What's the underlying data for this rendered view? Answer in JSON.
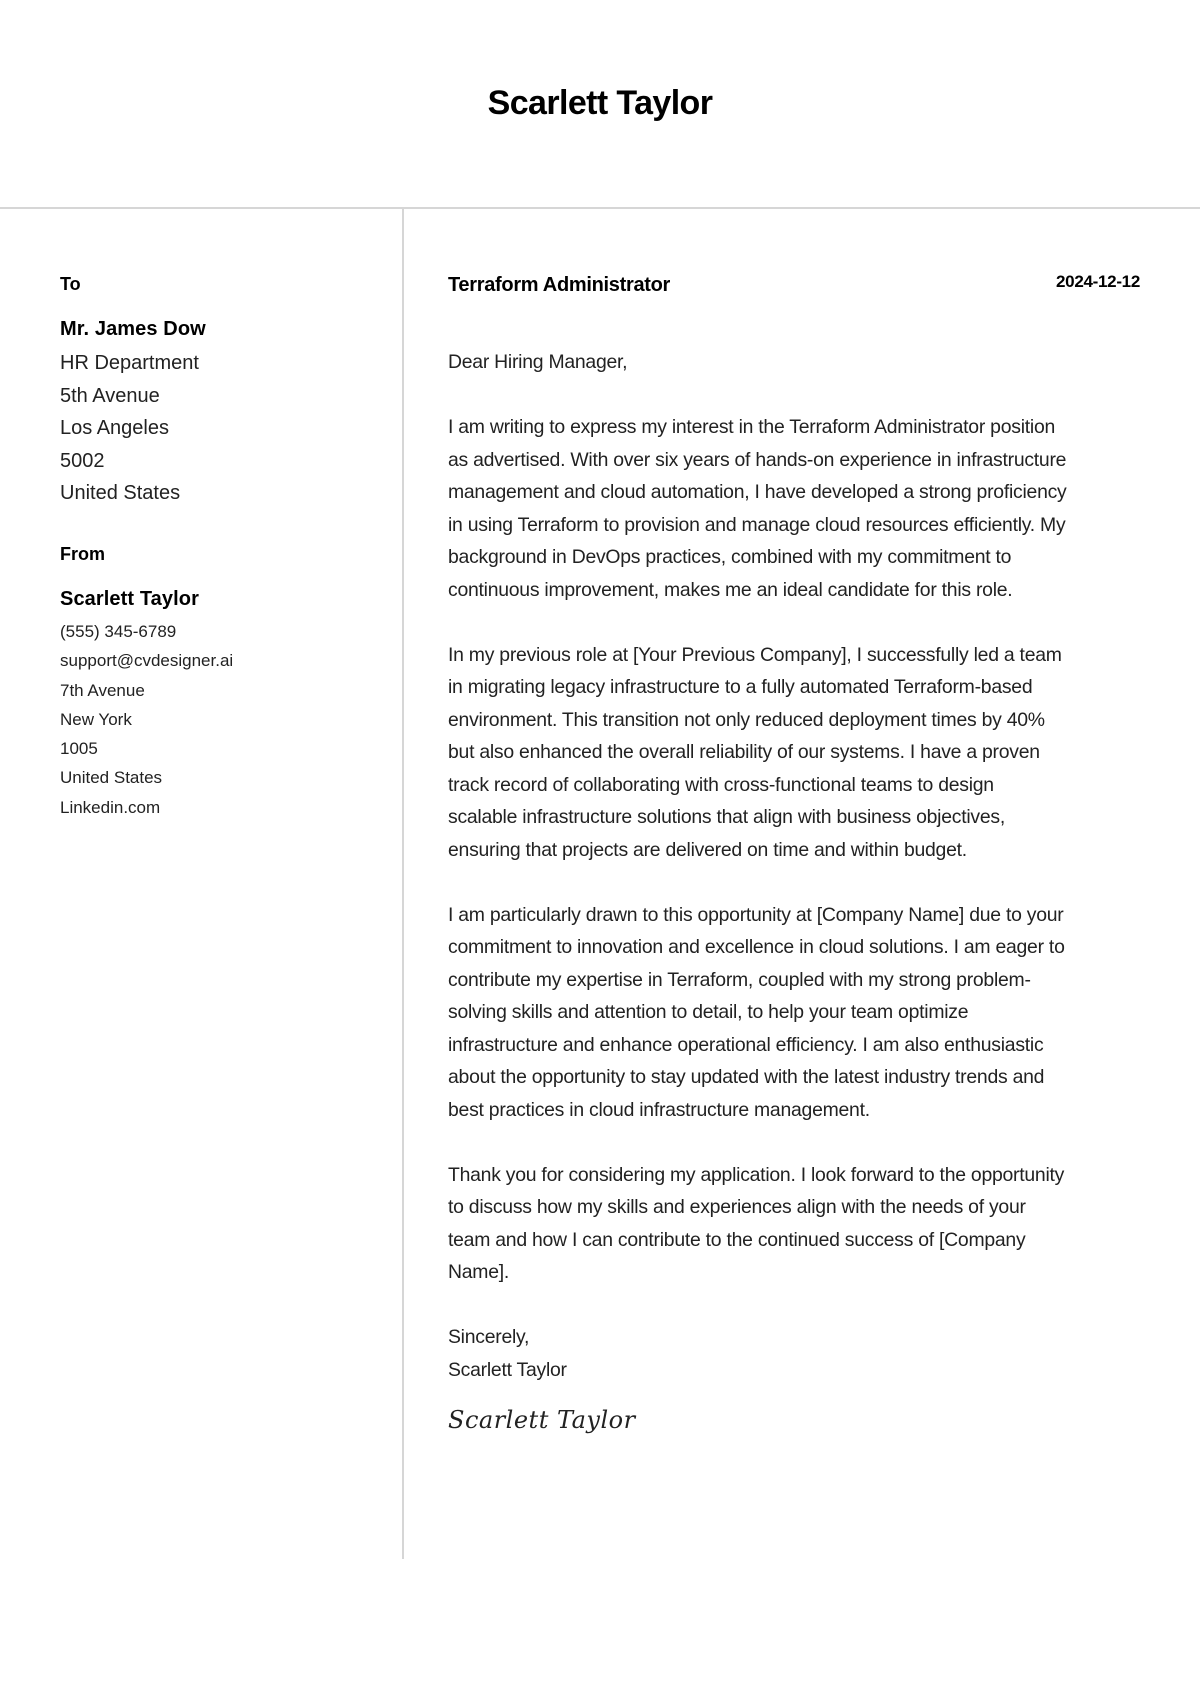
{
  "header": {
    "name": "Scarlett Taylor"
  },
  "recipient": {
    "label": "To",
    "name": "Mr. James Dow",
    "lines": [
      "HR Department",
      "5th Avenue",
      "Los Angeles",
      "5002",
      "United States"
    ]
  },
  "sender": {
    "label": "From",
    "name": "Scarlett Taylor",
    "phone": "(555) 345-6789",
    "email": "support@cvdesigner.ai",
    "street": "7th Avenue",
    "city": "New York",
    "postal_code": "1005",
    "country": "United States",
    "website": "Linkedin.com"
  },
  "letter": {
    "job_title": "Terraform Administrator",
    "date": "2024-12-12",
    "salutation": "Dear Hiring Manager,",
    "paragraphs": [
      [
        "I am writing to express my interest in the Terraform Administrator position",
        "as advertised. With over six years of hands-on experience in infrastructure",
        "management and cloud automation, I have developed a strong proficiency",
        "in using Terraform to provision and manage cloud resources efficiently. My",
        "background in DevOps practices, combined with my commitment to",
        "continuous improvement, makes me an ideal candidate for this role."
      ],
      [
        "In my previous role at [Your Previous Company], I successfully led a team",
        "in migrating legacy infrastructure to a fully automated Terraform-based",
        "environment. This transition not only reduced deployment times by 40%",
        "but also enhanced the overall reliability of our systems. I have a proven",
        "track record of collaborating with cross-functional teams to design",
        "scalable infrastructure solutions that align with business objectives,",
        "ensuring that projects are delivered on time and within budget."
      ],
      [
        "I am particularly drawn to this opportunity at [Company Name] due to your",
        "commitment to innovation and excellence in cloud solutions. I am eager to",
        "contribute my expertise in Terraform, coupled with my strong problem-",
        "solving skills and attention to detail, to help your team optimize",
        "infrastructure and enhance operational efficiency. I am also enthusiastic",
        "about the opportunity to stay updated with the latest industry trends and",
        "best practices in cloud infrastructure management."
      ],
      [
        "Thank you for considering my application. I look forward to the opportunity",
        "to discuss how my skills and experiences align with the needs of your",
        "team and how I can contribute to the continued success of [Company",
        "Name]."
      ]
    ],
    "closing": "Sincerely,",
    "closing_name": "Scarlett Taylor",
    "signature": "Scarlett Taylor"
  }
}
